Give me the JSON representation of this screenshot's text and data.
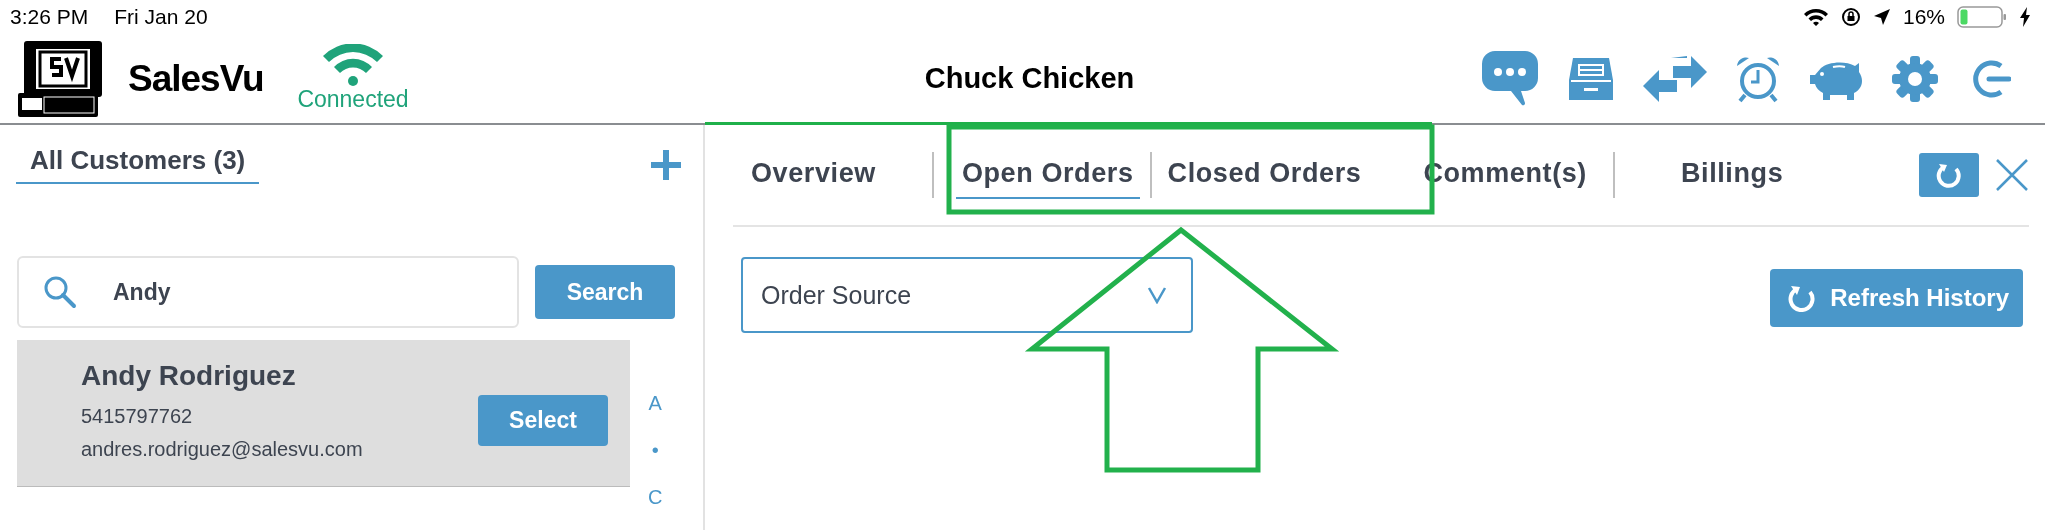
{
  "status_bar": {
    "time": "3:26 PM",
    "date": "Fri Jan 20",
    "battery_text": "16%"
  },
  "header": {
    "brand": "SalesVu",
    "connection": "Connected",
    "title": "Chuck Chicken"
  },
  "customers": {
    "heading": "All Customers (3)",
    "search": {
      "value": "Andy"
    },
    "search_button": "Search",
    "results": [
      {
        "name": "Andy Rodriguez",
        "phone": "5415797762",
        "email": "andres.rodriguez@salesvu.com",
        "action": "Select",
        "selected": true
      }
    ],
    "index_letters": [
      "A",
      "•",
      "C"
    ]
  },
  "detail": {
    "tabs": [
      {
        "label": "Overview",
        "selected": false
      },
      {
        "label": "Open Orders",
        "selected": true
      },
      {
        "label": "Closed Orders",
        "selected": false
      },
      {
        "label": "Comment(s)",
        "selected": false
      },
      {
        "label": "Billings",
        "selected": false
      }
    ],
    "order_source": {
      "value": "Order Source"
    },
    "refresh_button": "Refresh History"
  }
}
